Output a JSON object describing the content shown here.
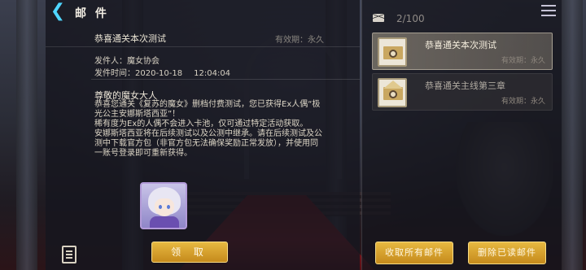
{
  "header": {
    "title": "邮 件"
  },
  "detail": {
    "subject": "恭喜通关本次测试",
    "expiry_label": "有效期：永久",
    "sender": "发件人：魔女协会",
    "send_time_label": "发件时间：",
    "send_date": "2020-10-18",
    "send_time": "12:04:04",
    "greeting": "尊敬的魔女大人",
    "body_lines": [
      "恭喜您通关《复苏的魔女》删档付费测试，您已获得Ex人偶“极",
      "光公主安娜斯塔西亚”！",
      "稀有度为Ex的人偶不会进入卡池，仅可通过特定活动获取。",
      "安娜斯塔西亚将在后续测试以及公测中继承。请在后续测试及公",
      "测中下载官方包（非官方包无法确保奖励正常发放），并使用同",
      "一账号登录即可重新获得。"
    ],
    "claim_label": "领 取"
  },
  "mail_list": {
    "count": "2/100",
    "items": [
      {
        "title": "恭喜通关本次测试",
        "expiry": "有效期：永久",
        "state": "active"
      },
      {
        "title": "恭喜通关主线第三章",
        "expiry": "有效期：永久",
        "state": "read"
      }
    ],
    "collect_all_label": "收取所有邮件",
    "delete_read_label": "删除已读邮件"
  },
  "colors": {
    "accent_gold": "#e7b941",
    "back_arrow": "#4fd6ff",
    "reward_frame": "#b39bd9"
  },
  "icons": [
    "back-arrow-icon",
    "envelope-icon",
    "menu-icon",
    "document-icon",
    "mail-envelope-icon"
  ]
}
